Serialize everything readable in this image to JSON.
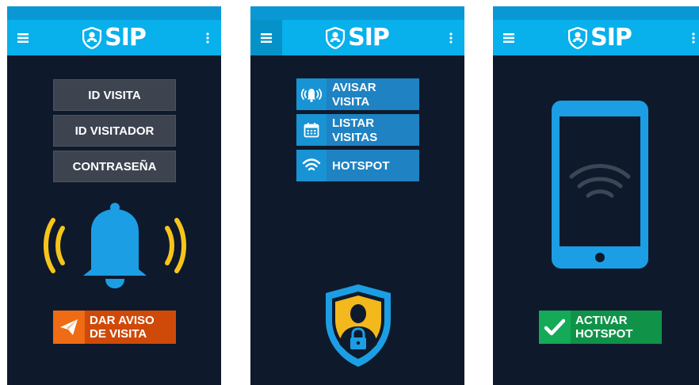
{
  "app": {
    "name": "SIP"
  },
  "colors": {
    "background": "#0e1a2c",
    "appbar": "#08b0ec",
    "statusbar": "#0a98d4",
    "gray_button": "#3d4450",
    "orange_button": "#cf4a08",
    "blue_button": "#1e82c3",
    "green_button": "#109349",
    "bell_blue": "#1c9ee4",
    "bell_waves": "#f7c51a"
  },
  "screen1": {
    "buttons": [
      {
        "label": "ID VISITA"
      },
      {
        "label": "ID VISITADOR"
      },
      {
        "label": "CONTRASEÑA"
      }
    ],
    "action": {
      "line1": "DAR AVISO",
      "line2": "DE VISITA",
      "icon": "paper-plane-icon"
    }
  },
  "screen2": {
    "menu": [
      {
        "line1": "AVISAR",
        "line2": "VISITA",
        "icon": "bell-ring-icon"
      },
      {
        "line1": "LISTAR",
        "line2": "VISITAS",
        "icon": "calendar-icon"
      },
      {
        "line1": "HOTSPOT",
        "line2": "",
        "icon": "wifi-icon"
      }
    ]
  },
  "screen3": {
    "action": {
      "line1": "ACTIVAR",
      "line2": "HOTSPOT",
      "icon": "check-icon"
    }
  }
}
